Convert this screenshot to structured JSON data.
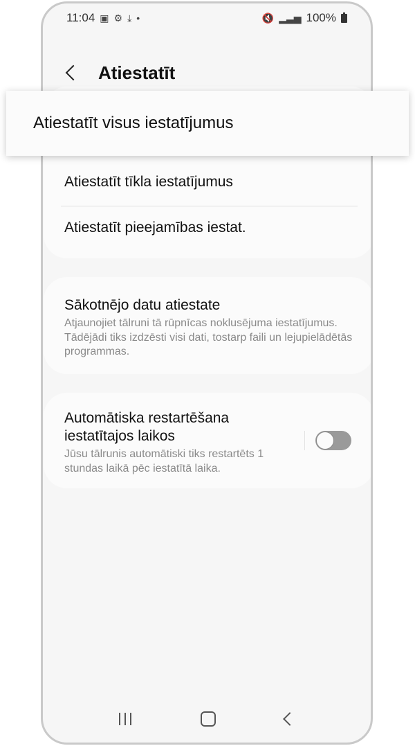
{
  "status_bar": {
    "time": "11:04",
    "left_icons": [
      "gallery-icon",
      "settings-icon",
      "download-icon",
      "dot-icon"
    ],
    "right_icons": [
      "mute-vibrate-icon",
      "signal-icon",
      "battery-icon"
    ],
    "battery_text": "100%"
  },
  "header": {
    "title": "Atiestatīt"
  },
  "highlight_item": {
    "label": "Atiestatīt visus iestatījumus"
  },
  "list": {
    "network_label": "Atiestatīt tīkla iestatījumus",
    "accessibility_label": "Atiestatīt pieejamības iestat."
  },
  "factory_reset": {
    "title": "Sākotnējo datu atiestate",
    "description": "Atjaunojiet tālruni tā rūpnīcas noklusējuma iestatījumus. Tādējādi tiks izdzēsti visi dati, tostarp faili un lejupielādētās programmas."
  },
  "auto_restart": {
    "title": "Automātiska restartēšana iestatītajos laikos",
    "description": "Jūsu tālrunis automātiski tiks restartēts 1 stundas laikā pēc iestatītā laika.",
    "toggle_on": false
  },
  "colors": {
    "background": "#f6f6f6",
    "card": "#fbfbfb",
    "secondary_text": "#8a8a8a",
    "toggle_off": "#9a9a9a"
  }
}
